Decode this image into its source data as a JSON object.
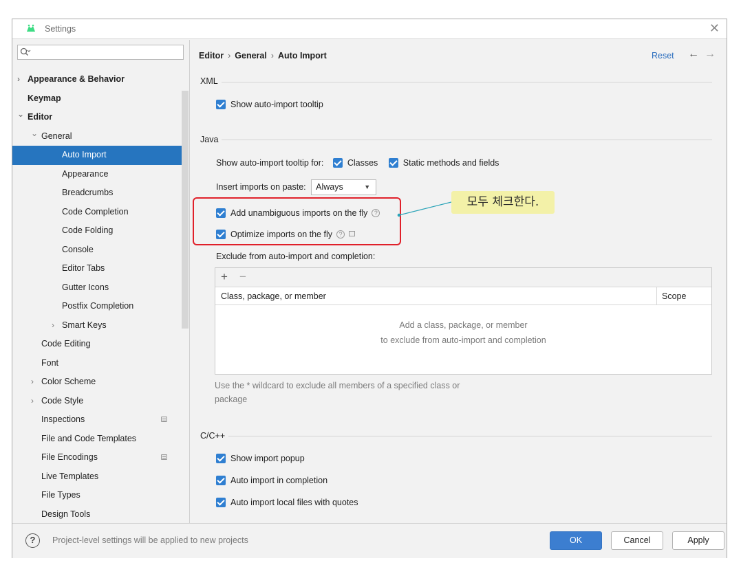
{
  "window": {
    "title": "Settings"
  },
  "search": {
    "placeholder": "",
    "value": ""
  },
  "sidebar": {
    "items": [
      {
        "label": "Appearance & Behavior",
        "level": 0,
        "bold": true,
        "chevron": "right"
      },
      {
        "label": "Keymap",
        "level": 0,
        "bold": true
      },
      {
        "label": "Editor",
        "level": 0,
        "bold": true,
        "chevron": "down"
      },
      {
        "label": "General",
        "level": 1,
        "chevron": "down"
      },
      {
        "label": "Auto Import",
        "level": 2,
        "selected": true
      },
      {
        "label": "Appearance",
        "level": 2
      },
      {
        "label": "Breadcrumbs",
        "level": 2
      },
      {
        "label": "Code Completion",
        "level": 2
      },
      {
        "label": "Code Folding",
        "level": 2
      },
      {
        "label": "Console",
        "level": 2
      },
      {
        "label": "Editor Tabs",
        "level": 2
      },
      {
        "label": "Gutter Icons",
        "level": 2
      },
      {
        "label": "Postfix Completion",
        "level": 2
      },
      {
        "label": "Smart Keys",
        "level": 2,
        "chevron": "right"
      },
      {
        "label": "Code Editing",
        "level": 1
      },
      {
        "label": "Font",
        "level": 1
      },
      {
        "label": "Color Scheme",
        "level": 1,
        "chevron": "right"
      },
      {
        "label": "Code Style",
        "level": 1,
        "chevron": "right"
      },
      {
        "label": "Inspections",
        "level": 1,
        "badge": true
      },
      {
        "label": "File and Code Templates",
        "level": 1
      },
      {
        "label": "File Encodings",
        "level": 1,
        "badge": true
      },
      {
        "label": "Live Templates",
        "level": 1
      },
      {
        "label": "File Types",
        "level": 1
      },
      {
        "label": "Design Tools",
        "level": 1
      }
    ]
  },
  "header": {
    "breadcrumb": [
      "Editor",
      "General",
      "Auto Import"
    ],
    "reset_label": "Reset"
  },
  "xml": {
    "section_label": "XML",
    "show_tooltip_label": "Show auto-import tooltip",
    "show_tooltip_checked": true
  },
  "java": {
    "section_label": "Java",
    "tooltip_for_label": "Show auto-import tooltip for:",
    "classes_label": "Classes",
    "classes_checked": true,
    "static_label": "Static methods and fields",
    "static_checked": true,
    "insert_label": "Insert imports on paste:",
    "insert_value": "Always",
    "unambiguous_label": "Add unambiguous imports on the fly",
    "unambiguous_checked": true,
    "optimize_label": "Optimize imports on the fly",
    "optimize_checked": true,
    "exclude_label": "Exclude from auto-import and completion:",
    "table": {
      "columns": [
        "Class, package, or member",
        "Scope"
      ],
      "empty_line1": "Add a class, package, or member",
      "empty_line2": "to exclude from auto-import and completion"
    },
    "hint_line1": "Use the * wildcard to exclude all members of a specified class or",
    "hint_line2": "package"
  },
  "cpp": {
    "section_label": "C/C++",
    "popup_label": "Show import popup",
    "completion_label": "Auto import in completion",
    "local_label": "Auto import local files with quotes"
  },
  "annotation": {
    "callout_text": "모두 체크한다."
  },
  "footer": {
    "note": "Project-level settings will be applied to new projects",
    "ok_label": "OK",
    "cancel_label": "Cancel",
    "apply_label": "Apply"
  },
  "colors": {
    "selection": "#2675bf",
    "accent": "#2f7fd1",
    "link": "#2d6fbf",
    "highlight": "#e0202a",
    "callout_bg": "#f3f1a8"
  }
}
